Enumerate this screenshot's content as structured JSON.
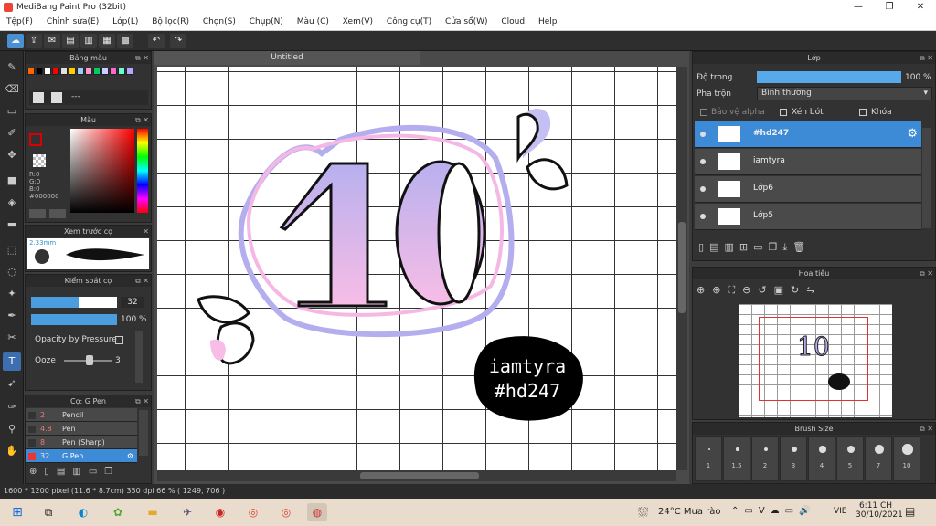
{
  "window": {
    "title": "MediBang Paint Pro (32bit)",
    "minimize": "—",
    "maximize": "❐",
    "close": "✕"
  },
  "menu": [
    "Tệp(F)",
    "Chỉnh sửa(E)",
    "Lớp(L)",
    "Bộ lọc(R)",
    "Chọn(S)",
    "Chụp(N)",
    "Màu (C)",
    "Xem(V)",
    "Công cụ(T)",
    "Cửa sổ(W)",
    "Cloud",
    "Help"
  ],
  "doc_tab": "Untitled",
  "palette": {
    "title": "Bảng màu",
    "name": "---",
    "colors": [
      "#ff6600",
      "#000000",
      "#ffffff",
      "#ff0000",
      "#e0e0e0",
      "#ffcc00",
      "#99ccff",
      "#ff99cc",
      "#00cc66",
      "#ccccff",
      "#ff66cc",
      "#66ffcc",
      "#b5a6ff"
    ]
  },
  "color": {
    "title": "Màu",
    "r": "R:0",
    "g": "G:0",
    "b": "B:0",
    "hex": "#000000",
    "fg": "#000000"
  },
  "preview": {
    "title": "Xem trước cọ",
    "size": "2.33mm"
  },
  "brush_ctrl": {
    "title": "Kiểm soát cọ",
    "size": "32",
    "opacity": "100 %",
    "size_frac": 0.55,
    "opacity_frac": 1.0,
    "pressure_label": "Opacity by Pressure",
    "ooze_label": "Ooze",
    "ooze_val": "3"
  },
  "brushes": {
    "title": "Cọ: G Pen",
    "items": [
      {
        "num": "2",
        "name": "Pencil"
      },
      {
        "num": "4.8",
        "name": "Pen"
      },
      {
        "num": "8",
        "name": "Pen (Sharp)"
      },
      {
        "num": "32",
        "name": "G Pen"
      }
    ]
  },
  "layer_panel": {
    "title": "Lớp",
    "opacity_label": "Độ trong",
    "opacity_val": "100 %",
    "opacity_frac": 1.0,
    "blend_label": "Pha trộn",
    "blend_val": "Bình thường",
    "protect_alpha": "Bảo vệ alpha",
    "clipping": "Xén bớt",
    "lock": "Khóa",
    "layers": [
      "#hd247",
      "iamtyra",
      "Lớp6",
      "Lớp5"
    ]
  },
  "navigator": {
    "title": "Hoa tiêu"
  },
  "brush_size": {
    "title": "Brush Size",
    "sizes": [
      "1",
      "1.5",
      "2",
      "3",
      "4",
      "5",
      "7",
      "10"
    ]
  },
  "artwork": {
    "number": "10",
    "sticker_line1": "iamtyra",
    "sticker_line2": "#hd247"
  },
  "status": {
    "text": "1600 * 1200 pixel  (11.6 * 8.7cm)  350 dpi  66 %  ( 1249, 706 )"
  },
  "taskbar": {
    "weather": "24°C  Mưa rào",
    "lang": "VIE",
    "time": "6:11 CH",
    "date": "30/10/2021"
  }
}
